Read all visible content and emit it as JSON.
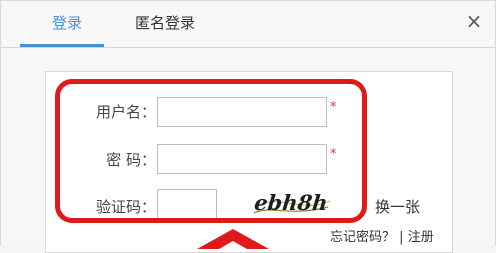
{
  "tabs": [
    {
      "label": "登录",
      "active": true
    },
    {
      "label": "匿名登录",
      "active": false
    }
  ],
  "close_icon": "×",
  "form": {
    "username_label": "用户名：",
    "username_value": "",
    "password_label": "密  码：",
    "password_value": "",
    "captcha_label": "验证码：",
    "captcha_value": "",
    "required_mark": "*",
    "captcha_text": "ebh8h",
    "refresh_label": "换一张",
    "forgot_label": "忘记密码？",
    "separator": "|",
    "register_label": "注册"
  },
  "colors": {
    "accent": "#4a90d9",
    "highlight": "#e0191b",
    "required": "#e23b3b"
  }
}
